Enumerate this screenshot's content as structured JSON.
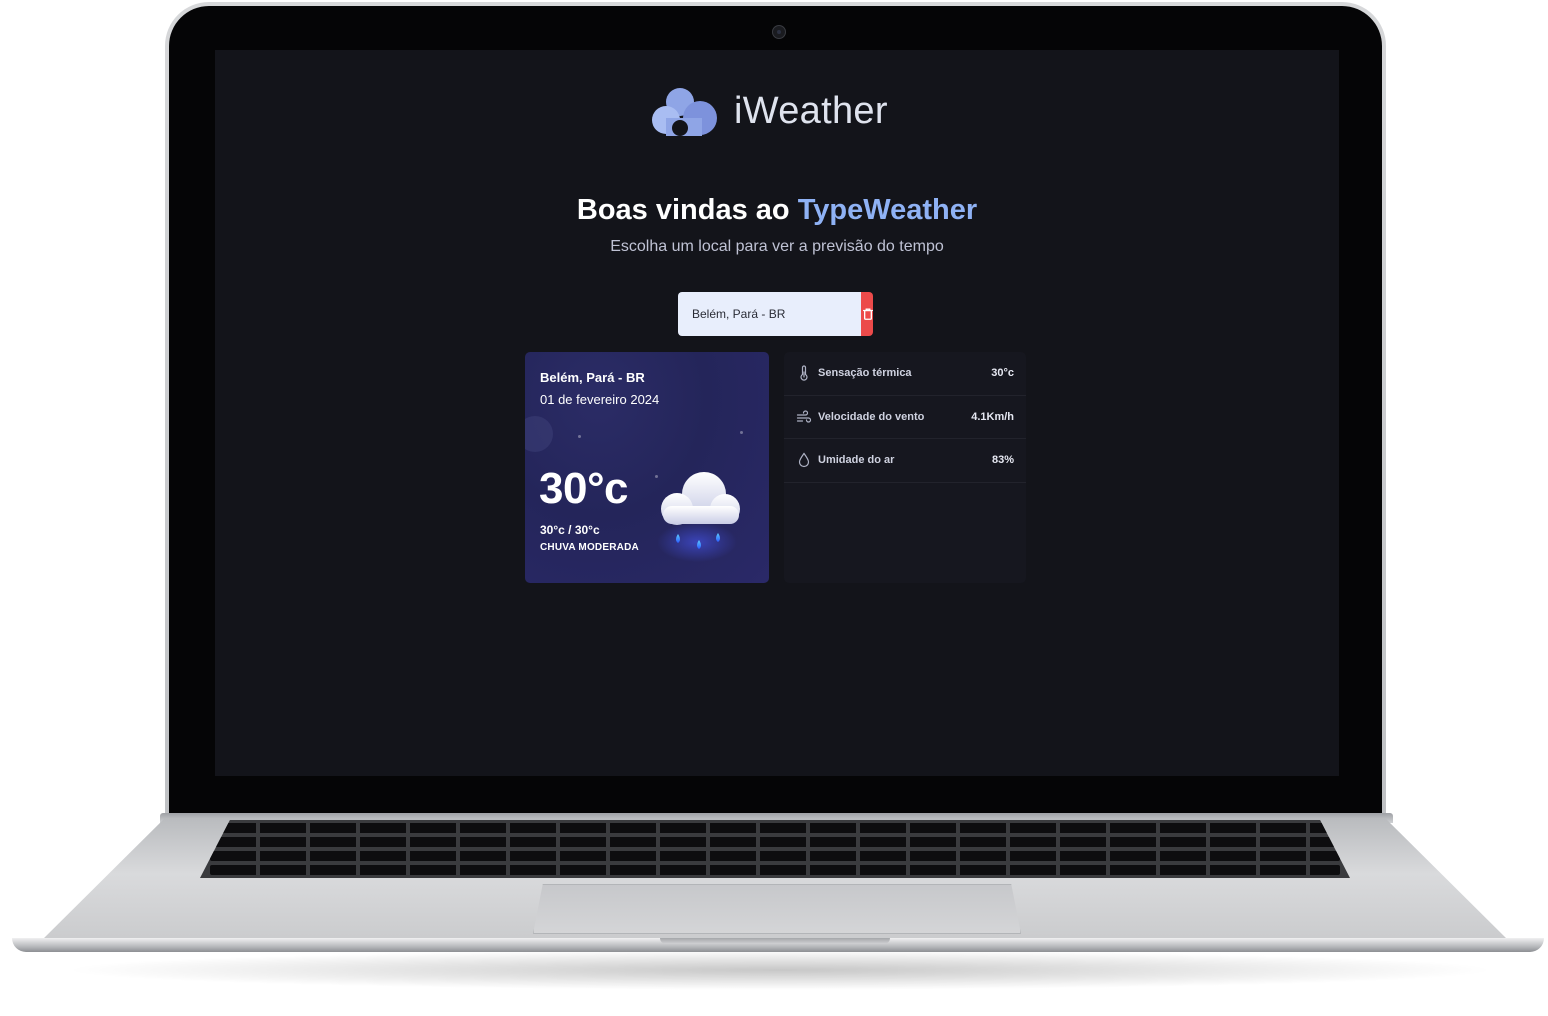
{
  "app": {
    "name": "iWeather"
  },
  "welcome": {
    "title_prefix": "Boas vindas ao ",
    "title_accent": "TypeWeather",
    "subtitle": "Escolha um local para ver a previsão do tempo"
  },
  "search": {
    "value": "Belém, Pará - BR",
    "clear_icon": "trash-icon",
    "clear_color": "#ec4a4a"
  },
  "weather": {
    "city": "Belém, Pará - BR",
    "date": "01 de fevereiro 2024",
    "temp": "30°c",
    "minmax": "30°c / 30°c",
    "description": "CHUVA MODERADA",
    "illustration": "rain-cloud-icon"
  },
  "details": [
    {
      "icon": "thermometer-icon",
      "label": "Sensação térmica",
      "value": "30°c"
    },
    {
      "icon": "wind-icon",
      "label": "Velocidade do vento",
      "value": "4.1Km/h"
    },
    {
      "icon": "droplet-icon",
      "label": "Umidade do ar",
      "value": "83%"
    }
  ],
  "colors": {
    "accent": "#8fb2f5",
    "background": "#13141a",
    "card": "#24255a",
    "danger": "#ec4a4a"
  }
}
